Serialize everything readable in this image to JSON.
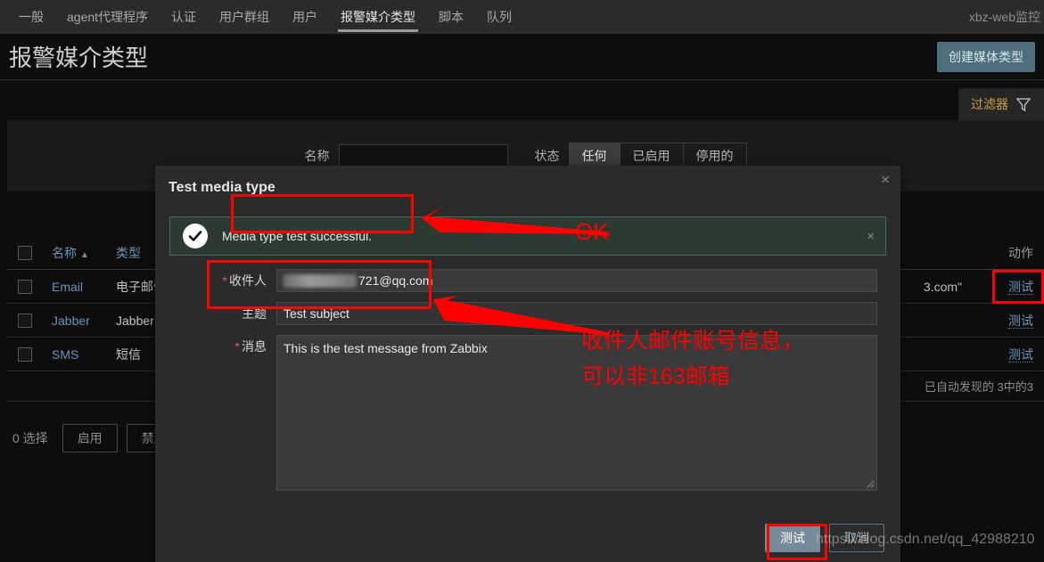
{
  "topnav": {
    "items": [
      {
        "label": "一般",
        "active": false
      },
      {
        "label": "agent代理程序",
        "active": false
      },
      {
        "label": "认证",
        "active": false
      },
      {
        "label": "用户群组",
        "active": false
      },
      {
        "label": "用户",
        "active": false
      },
      {
        "label": "报警媒介类型",
        "active": true
      },
      {
        "label": "脚本",
        "active": false
      },
      {
        "label": "队列",
        "active": false
      }
    ],
    "user": "xbz-web监控"
  },
  "header": {
    "title": "报警媒介类型",
    "create_button": "创建媒体类型"
  },
  "filter": {
    "tab_label": "过滤器",
    "name_label": "名称",
    "name_value": "",
    "name_placeholder": "",
    "status_label": "状态",
    "status_options": [
      {
        "label": "任何",
        "active": true
      },
      {
        "label": "已启用",
        "active": false
      },
      {
        "label": "停用的",
        "active": false
      }
    ]
  },
  "table": {
    "columns": {
      "name": "名称",
      "sort_arrow": "▲",
      "type": "类型",
      "actions": "动作"
    },
    "rows": [
      {
        "name": "Email",
        "type": "电子邮件",
        "details": "3.com\"",
        "action": "测试"
      },
      {
        "name": "Jabber",
        "type": "Jabber",
        "details": "",
        "action": "测试"
      },
      {
        "name": "SMS",
        "type": "短信",
        "details": "",
        "action": "测试"
      }
    ],
    "footer": "已自动发现的 3中的3"
  },
  "actionbar": {
    "selection": "0 选择",
    "enable_button": "启用",
    "disable_button": "禁用"
  },
  "modal": {
    "title": "Test media type",
    "close_icon": "×",
    "message": {
      "text": "Media type test successful.",
      "icon": "check-circle",
      "close_icon": "×"
    },
    "fields": {
      "recipient_label": "收件人",
      "recipient_required": "*",
      "recipient_value": "721@qq.com",
      "subject_label": "主题",
      "subject_value": "Test subject",
      "message_label": "消息",
      "message_required": "*",
      "message_value": "This is the test message from Zabbix"
    },
    "buttons": {
      "test": "测试",
      "cancel": "取消"
    }
  },
  "annotations": {
    "ok_text": "OK",
    "note_line1": "收件人邮件账号信息，",
    "note_line2": "可以非163邮箱"
  },
  "watermark": "https://blog.csdn.net/qq_42988210",
  "colors": {
    "accent_red": "#fe0000",
    "link_blue": "#6a93b5",
    "success_green": "#4c6a55",
    "primary_button": "#4d6f7c"
  }
}
